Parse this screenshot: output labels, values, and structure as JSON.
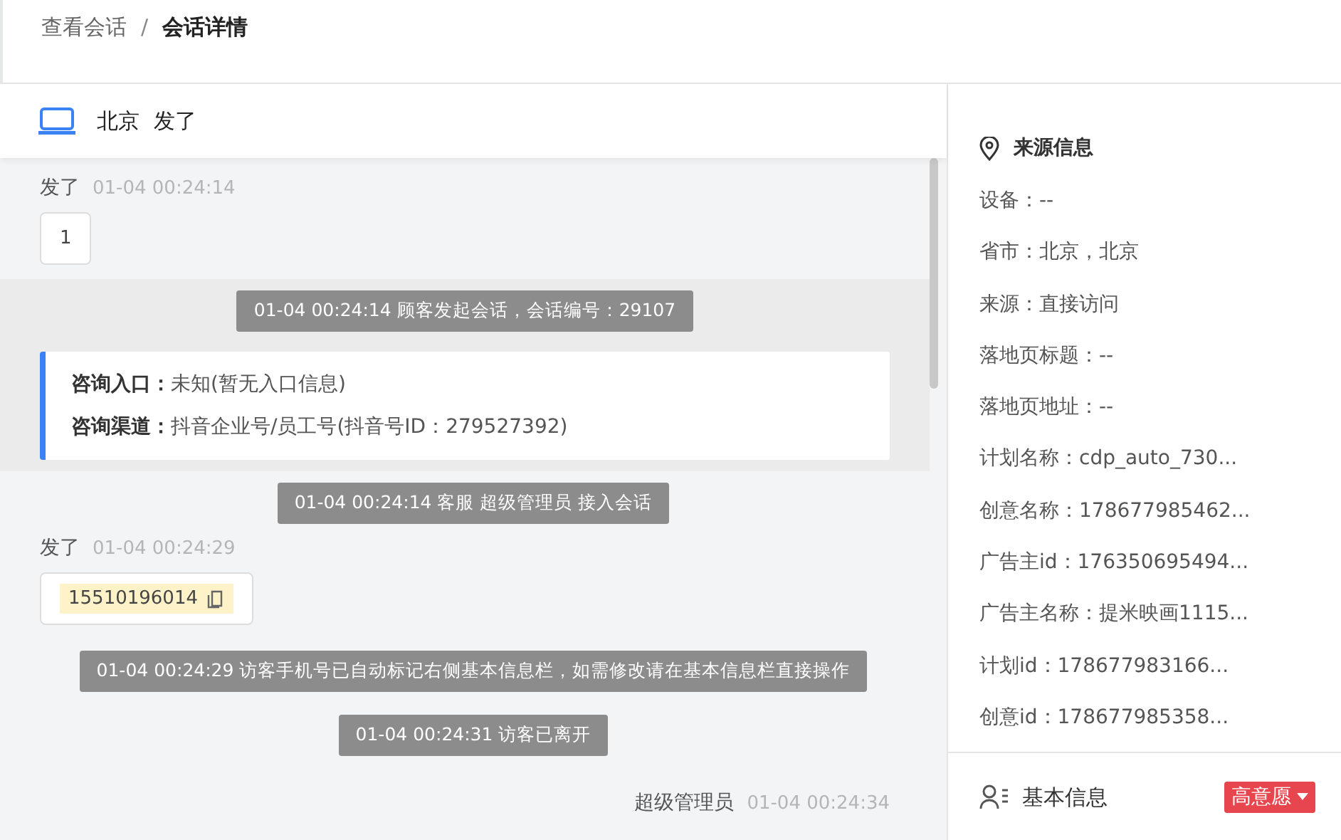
{
  "breadcrumb": [
    {
      "label": "查看会话",
      "current": false
    },
    {
      "label": "会话详情",
      "current": true
    }
  ],
  "breadcrumb_separator": "/",
  "chat_header": {
    "location": "北京",
    "name": "发了"
  },
  "messages": [
    {
      "kind": "visitor",
      "sender": "发了",
      "time": "01-04 00:24:14",
      "text": "1"
    },
    {
      "kind": "session",
      "notice": "01-04 00:24:14 顾客发起会话，会话编号：29107",
      "rows": [
        {
          "label": "咨询入口：",
          "value": "未知(暂无入口信息)"
        },
        {
          "label": "咨询渠道：",
          "value": "抖音企业号/员工号(抖音号ID：279527392)"
        }
      ]
    },
    {
      "kind": "notice",
      "text": "01-04 00:24:14 客服 超级管理员 接入会话"
    },
    {
      "kind": "phone",
      "sender": "发了",
      "time": "01-04 00:24:29",
      "text": "15510196014"
    },
    {
      "kind": "notice",
      "text": "01-04 00:24:29 访客手机号已自动标记右侧基本信息栏，如需修改请在基本信息栏直接操作"
    },
    {
      "kind": "notice",
      "text": "01-04 00:24:31 访客已离开"
    },
    {
      "kind": "agent",
      "sender": "超级管理员",
      "time": "01-04 00:24:34"
    }
  ],
  "source_info": {
    "title": "来源信息",
    "rows": [
      "设备：--",
      "省市：北京，北京",
      "来源：直接访问",
      "落地页标题：--",
      "落地页地址：--",
      "计划名称：cdp_auto_730...",
      "创意名称：178677985462...",
      "广告主id：176350695494...",
      "广告主名称：提米映画1115...",
      "计划id：178677983166...",
      "创意id：178677985358..."
    ]
  },
  "basic_info": {
    "title": "基本信息",
    "intent_tag": "高意愿"
  }
}
